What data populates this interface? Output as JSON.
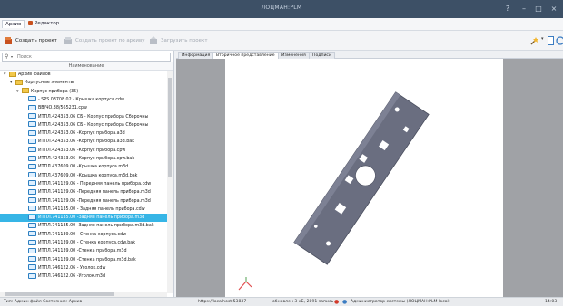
{
  "window": {
    "title": "ЛОЦМАН:PLM"
  },
  "menu": {
    "items": [
      "Архив",
      "Редактор"
    ]
  },
  "toolbar": {
    "create_project": "Создать проект",
    "create_from_archive": "Создать проект по архиву",
    "upload_project": "Загрузить проект"
  },
  "search": {
    "placeholder": "Поиск"
  },
  "tree_header": "Наименование",
  "tree": [
    {
      "label": "Архив файлов",
      "type": "folder",
      "level": 0
    },
    {
      "label": "Корпусные элементы",
      "type": "folder",
      "level": 1
    },
    {
      "label": "Корпус прибора (35)",
      "type": "folder",
      "level": 2
    },
    {
      "label": "- SPS.03708.02 - Крышка корпуса.cdw",
      "type": "doc",
      "level": 3
    },
    {
      "label": "ВВ/ЧО.38/565231.cpw",
      "type": "doc",
      "level": 3
    },
    {
      "label": "ИТПЛ.424353.06 СБ - Корпус прибора Сборочны",
      "type": "doc",
      "level": 3
    },
    {
      "label": "ИТПЛ.424353.06 СБ - Корпус прибора Сборочны",
      "type": "doc",
      "level": 3
    },
    {
      "label": "ИТПЛ.424353.06 -Корпус прибора.a3d",
      "type": "doc",
      "level": 3
    },
    {
      "label": "ИТПЛ.424353.06 -Корпус прибора.a3d.bak",
      "type": "doc",
      "level": 3
    },
    {
      "label": "ИТПЛ.424353.06 -Корпус прибора.cpw",
      "type": "doc",
      "level": 3
    },
    {
      "label": "ИТПЛ.424353.06 -Корпус прибора.cpw.bak",
      "type": "doc",
      "level": 3
    },
    {
      "label": "ИТПЛ.437609.00 -Крышка корпуса.m3d",
      "type": "doc",
      "level": 3
    },
    {
      "label": "ИТПЛ.437609.00 -Крышка корпуса.m3d.bak",
      "type": "doc",
      "level": 3
    },
    {
      "label": "ИТПЛ.741129.06 - Передняя панель прибора.cdw",
      "type": "doc",
      "level": 3
    },
    {
      "label": "ИТПЛ.741129.06 -Передняя панель прибора.m3d",
      "type": "doc",
      "level": 3
    },
    {
      "label": "ИТПЛ.741129.06 -Передняя панель прибора.m3d",
      "type": "doc",
      "level": 3
    },
    {
      "label": "ИТПЛ.741135.00 - Задняя панель прибора.cdw",
      "type": "doc",
      "level": 3
    },
    {
      "label": "ИТПЛ.741135.00 -Задняя панель прибора.m3d",
      "type": "doc",
      "level": 3,
      "selected": true
    },
    {
      "label": "ИТПЛ.741135.00 -Задняя панель прибора.m3d.bak",
      "type": "doc",
      "level": 3
    },
    {
      "label": "ИТПЛ.741139.00 - Стенка корпуса.cdw",
      "type": "doc",
      "level": 3
    },
    {
      "label": "ИТПЛ.741139.00 - Стенка корпуса.cdw.bak",
      "type": "doc",
      "level": 3
    },
    {
      "label": "ИТПЛ.741139.00 -Стенка прибора.m3d",
      "type": "doc",
      "level": 3
    },
    {
      "label": "ИТПЛ.741139.00 -Стенка прибора.m3d.bak",
      "type": "doc",
      "level": 3
    },
    {
      "label": "ИТПЛ.746122.06 - Уголок.cdw",
      "type": "doc",
      "level": 3
    },
    {
      "label": "ИТПЛ.746122.06 -Уголок.m3d",
      "type": "doc",
      "level": 3
    }
  ],
  "tabs": [
    "Информация",
    "Вторичное представление",
    "Изменения",
    "Подписи"
  ],
  "status": {
    "user": "Тип: Админ файл   Состояние: Архив",
    "path": "https://localhost:53837",
    "file_size": "обновлен 3 кБ, 2891 запись",
    "account": "Администратор системы (ЛОЦМАН:PLM-local)",
    "time": "14:03"
  },
  "colors": {
    "titlebar": "#3d5066",
    "selection": "#36b5e6",
    "part_fill": "#6a6e80",
    "viewer_bg": "#a0a2a6"
  }
}
